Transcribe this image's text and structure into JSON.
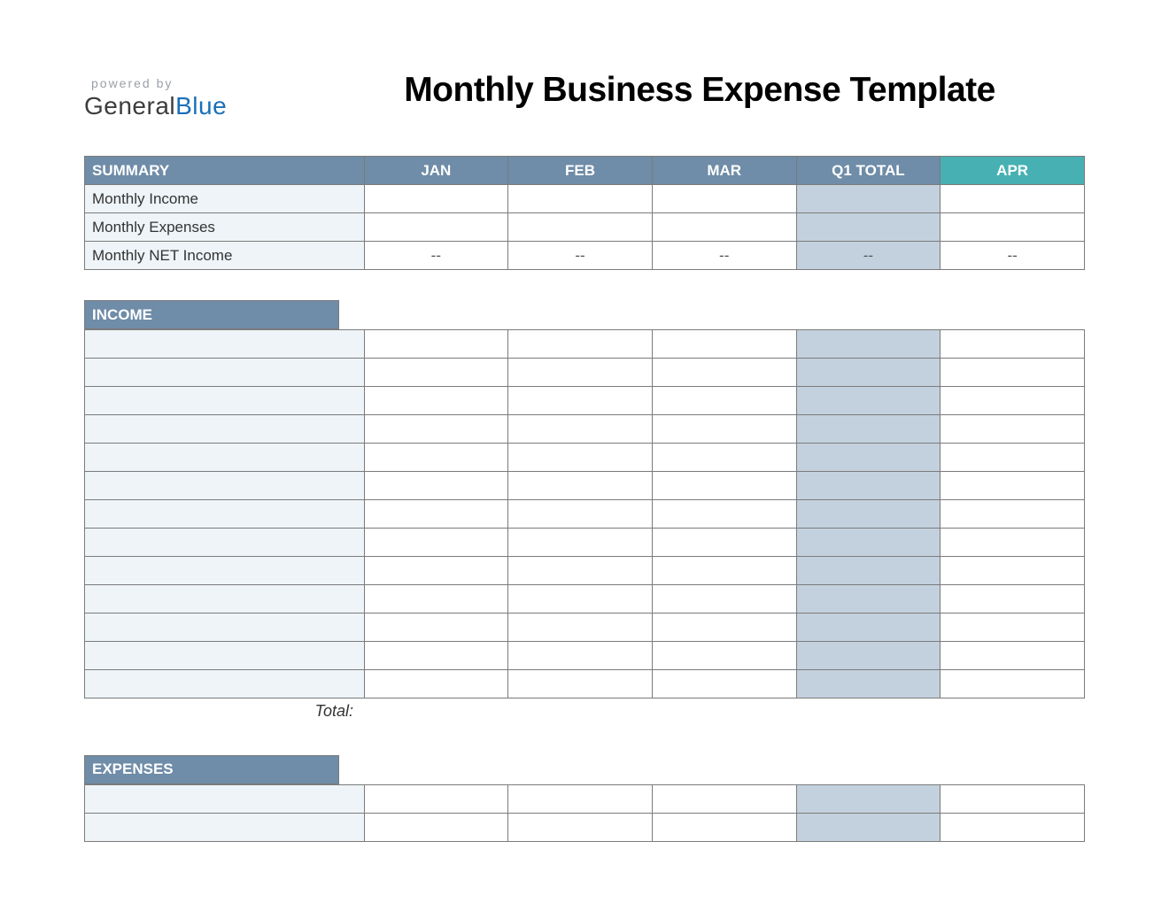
{
  "header": {
    "powered_by": "powered by",
    "brand_general": "General",
    "brand_blue": "Blue",
    "title": "Monthly Business Expense Template"
  },
  "summary": {
    "header_label": "SUMMARY",
    "columns": [
      "JAN",
      "FEB",
      "MAR",
      "Q1 TOTAL",
      "APR"
    ],
    "rows": [
      {
        "label": "Monthly Income",
        "values": [
          "",
          "",
          "",
          "",
          ""
        ]
      },
      {
        "label": "Monthly Expenses",
        "values": [
          "",
          "",
          "",
          "",
          ""
        ]
      },
      {
        "label": "Monthly NET Income",
        "values": [
          "--",
          "--",
          "--",
          "--",
          "--"
        ]
      }
    ]
  },
  "income": {
    "header_label": "INCOME",
    "row_count": 13,
    "total_label": "Total:"
  },
  "expenses": {
    "header_label": "EXPENSES",
    "row_count": 2
  },
  "colors": {
    "header_blue": "#6f8ca8",
    "header_teal": "#46b0b2",
    "q1_fill": "#c3d1de",
    "label_fill": "#eef4f8",
    "border": "#7b7b7b"
  }
}
